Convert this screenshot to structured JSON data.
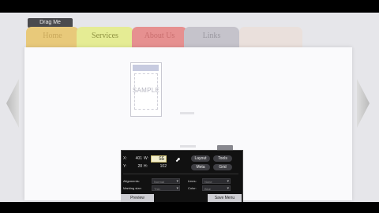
{
  "header": {
    "drag_handle_label": "Drag Me"
  },
  "tabs": [
    {
      "label": "Home"
    },
    {
      "label": "Services"
    },
    {
      "label": "About Us"
    },
    {
      "label": "Links"
    },
    {
      "label": ""
    }
  ],
  "preview": {
    "watermark": "SAMPLE"
  },
  "toolbox": {
    "x_label": "X:",
    "x_value": "401",
    "w_label": "W:",
    "w_value": "55",
    "y_label": "Y:",
    "y_value": "28",
    "h_label": "H:",
    "h_value": "102",
    "buttons": [
      "Layout",
      "Tools",
      "Meta",
      "Grid"
    ],
    "rows": [
      {
        "label": "Alignments:",
        "value": "Normal",
        "label2": "Lines:",
        "value2": "None"
      },
      {
        "label": "Marking size:",
        "value": "Thin",
        "label2": "Color:",
        "value2": "Blue"
      }
    ],
    "preview_button": "Preview",
    "save_button": "Save Menu"
  },
  "colors": {
    "tab_home": "#e8c97a",
    "tab_services": "#e5ec94",
    "tab_about": "#e69090",
    "tab_links": "#c5c3cb",
    "toolbox_bg": "#111111",
    "active_input": "#f2eecd"
  },
  "icons": [
    "chevron-left-icon",
    "chevron-right-icon",
    "cursor-icon"
  ]
}
